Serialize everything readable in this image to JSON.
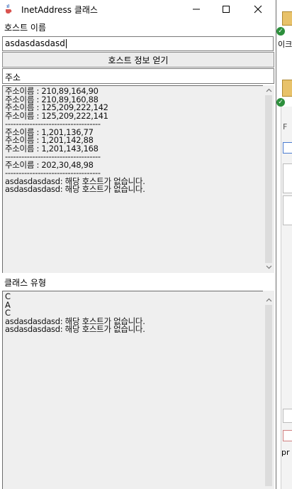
{
  "window": {
    "title": "InetAddress 클래스"
  },
  "host_label": "호스트 이름",
  "host_input": {
    "value": "asdasdasdasd"
  },
  "lookup_button": "호스트 정보 얻기",
  "address_field": "주소",
  "address_output": [
    "주소이름 : 210,89,164,90",
    "주소이름 : 210,89,160,88",
    "주소이름 : 125,209,222,142",
    "주소이름 : 125,209,222,141",
    "-----------------------------------",
    "주소이름 : 1,201,136,77",
    "주소이름 : 1,201,142,88",
    "주소이름 : 1,201,143,168",
    "-----------------------------------",
    "주소이름 : 202,30,48,98",
    "-----------------------------------",
    "asdasdasdasd: 해당 호스트가 없습니다.",
    "asdasdasdasd: 해당 호스트가 없습니다."
  ],
  "class_label": "클래스 유형",
  "class_output": [
    "C",
    "A",
    "C",
    "asdasdasdasd: 해당 호스트가 없습니다.",
    "asdasdasdasd: 해당 호스트가 없습니다."
  ],
  "background_app": {
    "text_1": "이크",
    "text_2": "F",
    "text_3": "pr"
  },
  "icons": {
    "app": "java-cup-icon",
    "minimize": "minimize-icon",
    "maximize": "maximize-icon",
    "close": "close-icon"
  }
}
